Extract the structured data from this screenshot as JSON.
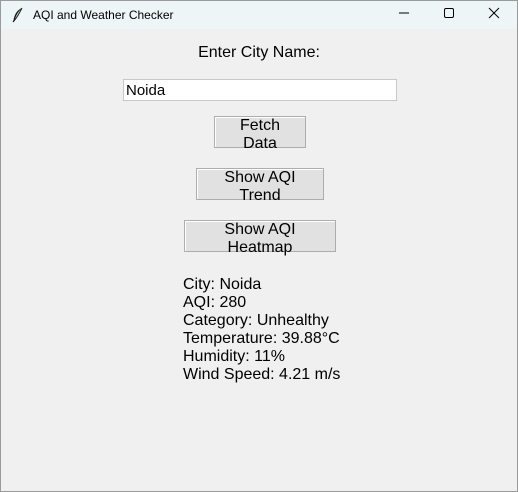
{
  "window": {
    "title": "AQI and Weather Checker",
    "app_icon": "feather-icon",
    "controls": [
      "minimize-icon",
      "maximize-icon",
      "close-icon"
    ]
  },
  "form": {
    "city_label": "Enter City Name:",
    "city_value": "Noida",
    "fetch_label": "Fetch Data",
    "trend_label": "Show AQI Trend",
    "heatmap_label": "Show AQI Heatmap"
  },
  "results": {
    "city": "City: Noida",
    "aqi": "AQI: 280",
    "category": "Category: Unhealthy",
    "temperature": "Temperature: 39.88°C",
    "humidity": "Humidity: 11%",
    "wind": "Wind Speed: 4.21 m/s"
  },
  "colors": {
    "titlebar_bg": "#eef5f6",
    "window_bg": "#f0f0f0",
    "button_bg": "#e1e1e1",
    "button_border": "#adadad"
  }
}
